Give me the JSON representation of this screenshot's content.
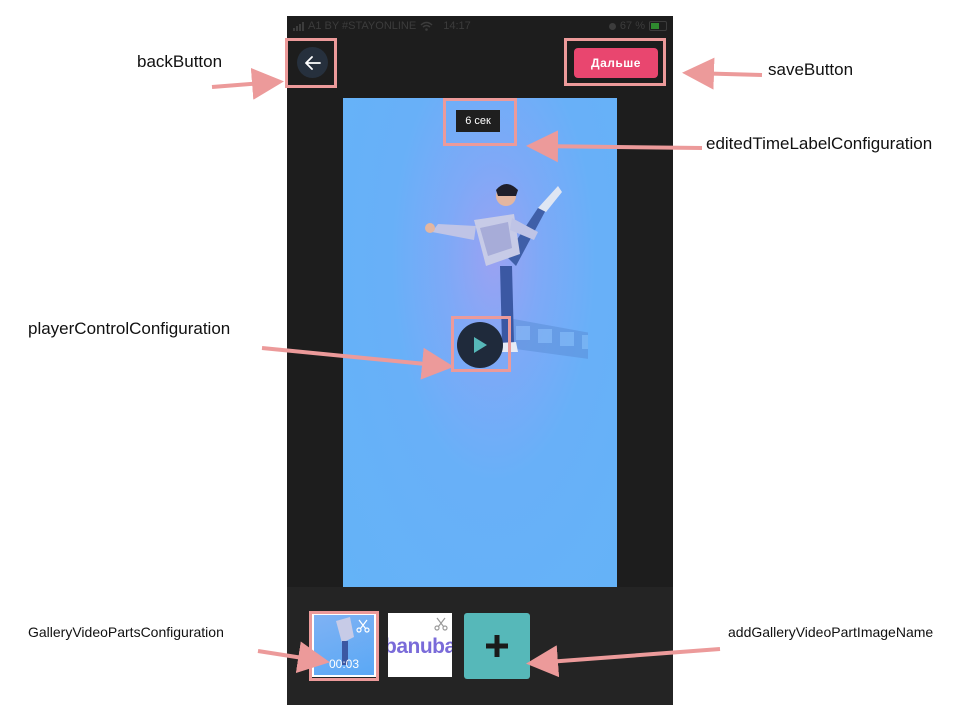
{
  "status_bar": {
    "carrier": "A1 BY #STAYONLINE",
    "time": "14:17",
    "battery": "67 %"
  },
  "header": {
    "back_icon": "arrow-left-icon",
    "save_label": "Дальше"
  },
  "player": {
    "edited_time_label": "6 сек",
    "play_icon": "play-icon"
  },
  "gallery": {
    "clips": [
      {
        "duration": "00:03",
        "icon": "scissors-icon"
      },
      {
        "logo_text": "banuba",
        "icon": "scissors-icon"
      }
    ],
    "add_icon": "plus-icon"
  },
  "annotations": {
    "back_button": "backButton",
    "save_button": "saveButton",
    "edited_time_label": "editedTimeLabelConfiguration",
    "player_control": "playerControlConfiguration",
    "gallery_video_parts": "GalleryVideoPartsConfiguration",
    "add_gallery_video_part": "addGalleryVideoPartImageName"
  },
  "colors": {
    "accent": "#e9466f",
    "add_button": "#56b8b9",
    "highlight": "#ec9a9a",
    "video_bg": "#64b3f7"
  }
}
